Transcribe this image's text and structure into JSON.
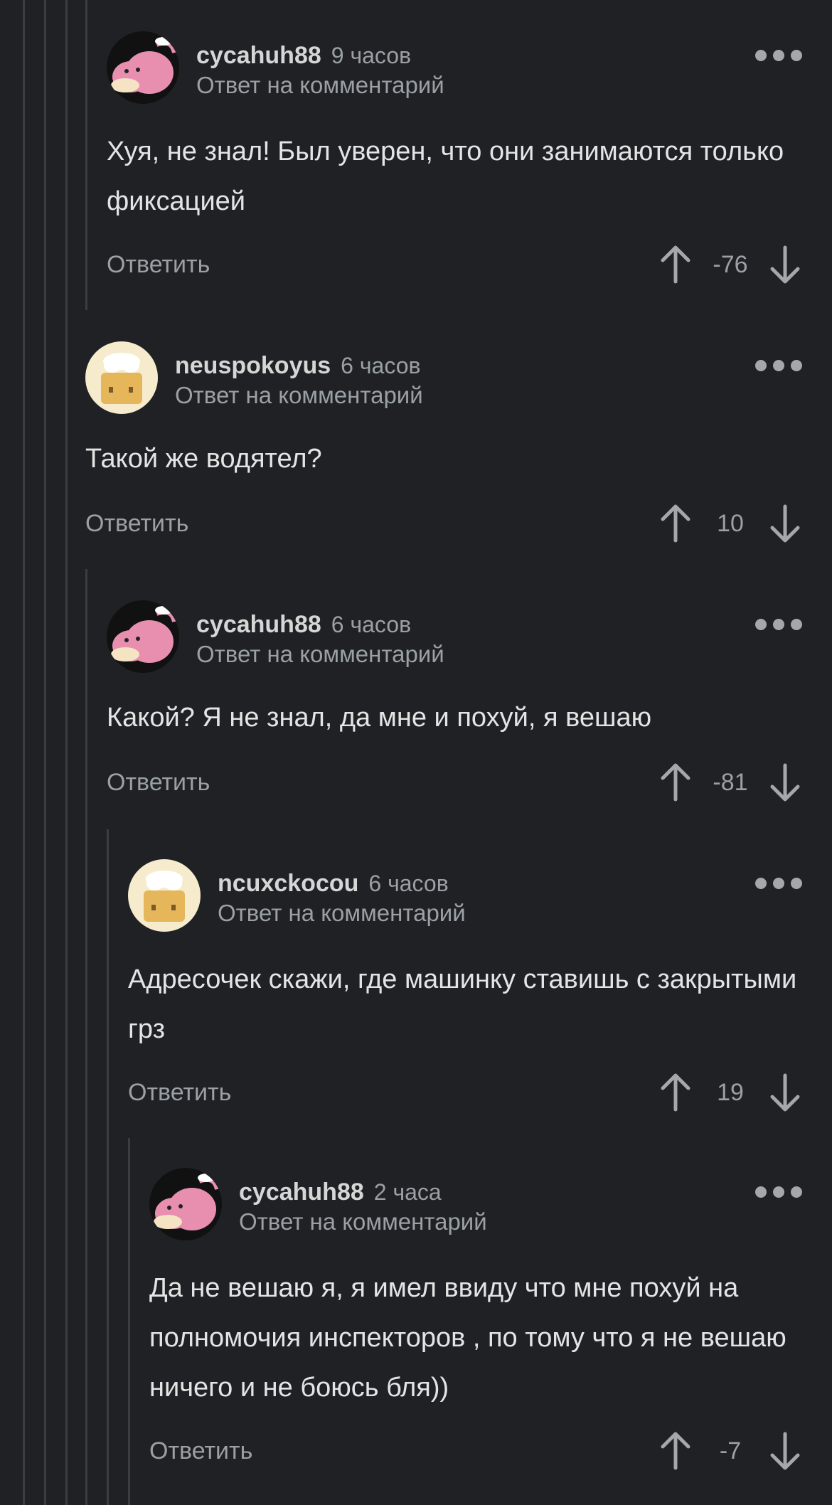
{
  "colors": {
    "background": "#1f2124",
    "thread_line": "#3a3d41",
    "text_primary": "#e4e4e4",
    "text_secondary": "#9aa0a6",
    "avatar_pink": "#e88fb0"
  },
  "icons": {
    "upvote": "arrow-up-icon",
    "downvote": "arrow-down-icon",
    "more": "more-dots-icon"
  },
  "comments": [
    {
      "avatar": "slowpoke-avatar",
      "username": "cycahuh88",
      "time": "9 часов",
      "reply_to": "Ответ на комментарий",
      "text": "Хуя, не знал! Был уверен, что они занимаются только фиксацией",
      "reply_label": "Ответить",
      "rating": "-76"
    },
    {
      "avatar": "cheese-avatar",
      "username": "neuspokoyus",
      "time": "6 часов",
      "reply_to": "Ответ на комментарий",
      "text": "Такой же водятел?",
      "reply_label": "Ответить",
      "rating": "10"
    },
    {
      "avatar": "slowpoke-avatar",
      "username": "cycahuh88",
      "time": "6 часов",
      "reply_to": "Ответ на комментарий",
      "text": "Какой? Я не знал, да мне и похуй, я вешаю",
      "reply_label": "Ответить",
      "rating": "-81"
    },
    {
      "avatar": "cheese-avatar",
      "username": "ncuxckocou",
      "time": "6 часов",
      "reply_to": "Ответ на комментарий",
      "text": "Адресочек скажи, где машинку ставишь с закрытыми грз",
      "reply_label": "Ответить",
      "rating": "19"
    },
    {
      "avatar": "slowpoke-avatar",
      "username": "cycahuh88",
      "time": "2 часа",
      "reply_to": "Ответ на комментарий",
      "text": "Да не вешаю я, я имел ввиду что мне похуй на полномочия инспекторов , по тому что я не вешаю ничего и не боюсь бля))",
      "reply_label": "Ответить",
      "rating": "-7"
    }
  ]
}
